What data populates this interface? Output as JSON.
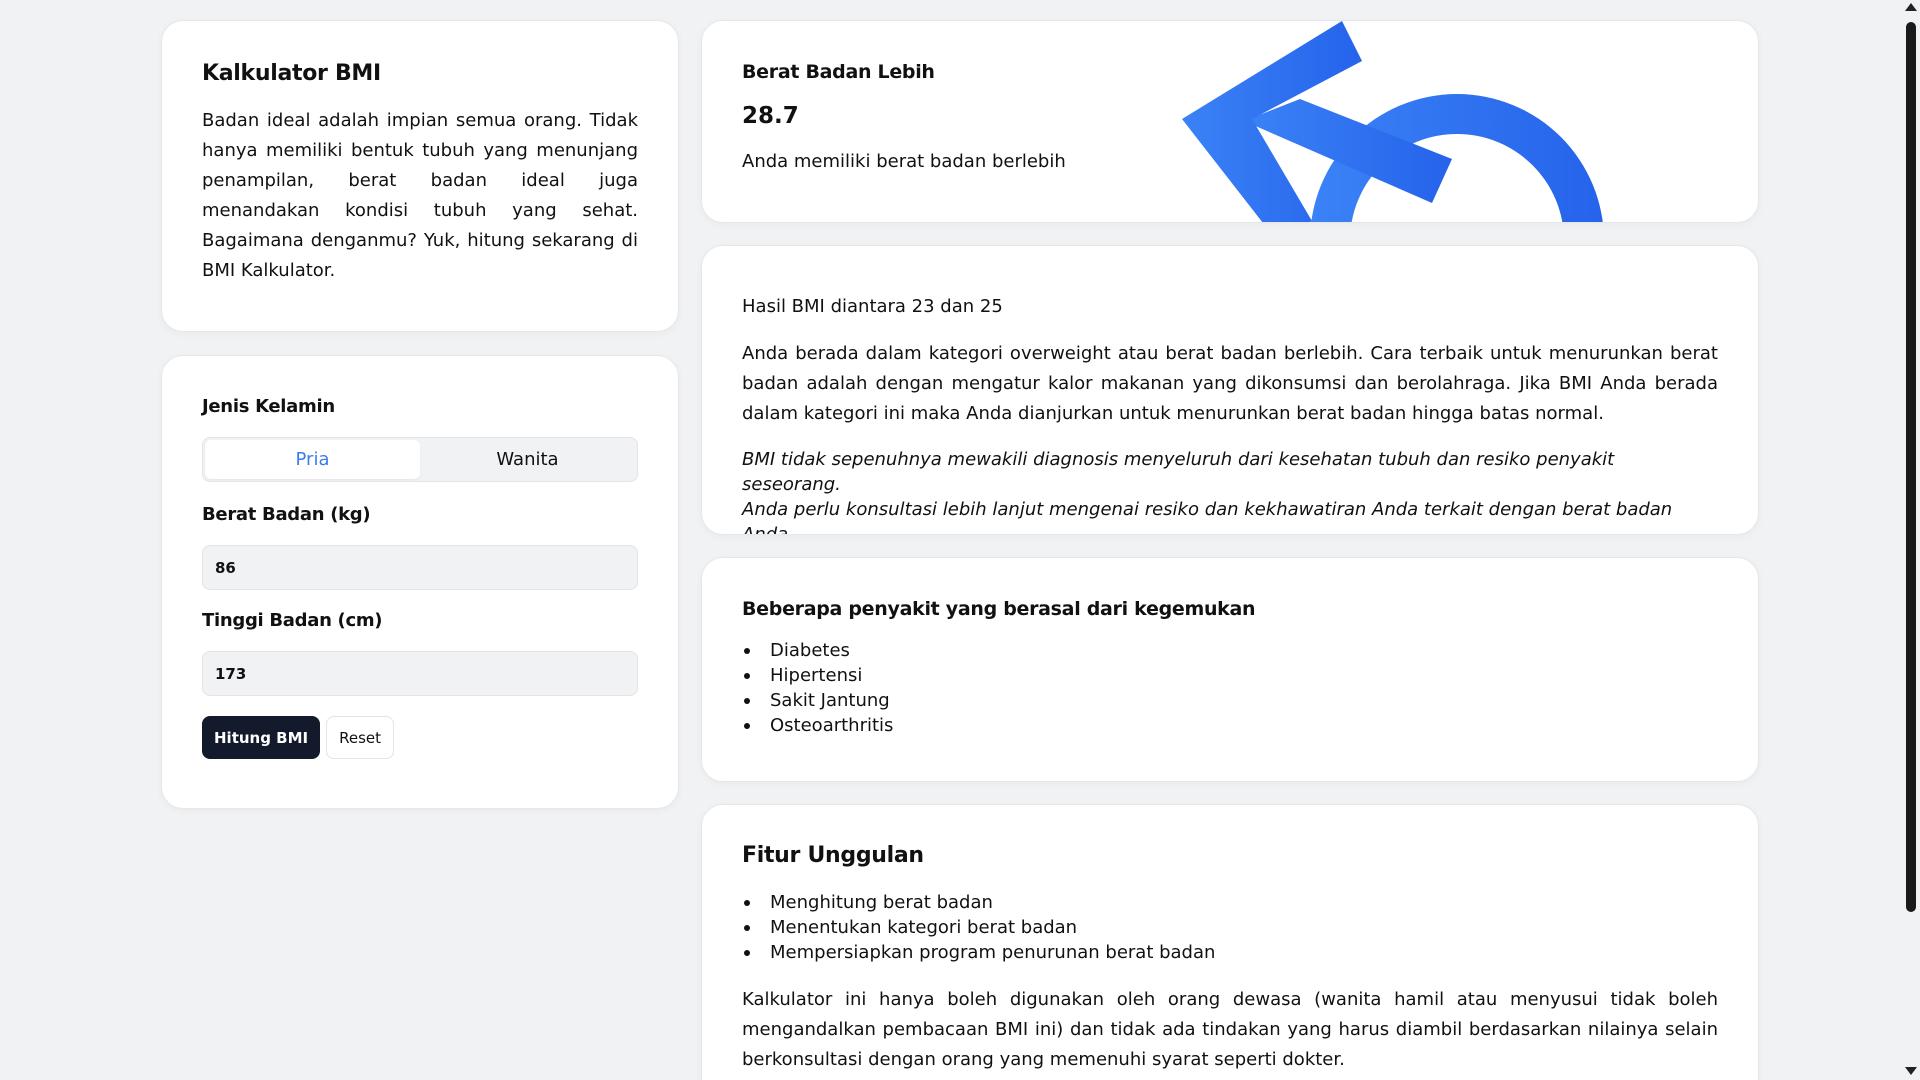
{
  "intro": {
    "title": "Kalkulator BMI",
    "text": "Badan ideal adalah impian semua orang. Tidak hanya memiliki bentuk tubuh yang menunjang penampilan, berat badan ideal juga menandakan kondisi tubuh yang sehat. Bagaimana denganmu? Yuk, hitung sekarang di BMI Kalkulator."
  },
  "form": {
    "gender_label": "Jenis Kelamin",
    "gender_options": [
      "Pria",
      "Wanita"
    ],
    "gender_selected": "Pria",
    "weight_label": "Berat Badan (kg)",
    "weight_value": "86",
    "height_label": "Tinggi Badan (cm)",
    "height_value": "173",
    "calc_button": "Hitung BMI",
    "reset_button": "Reset"
  },
  "result": {
    "category": "Berat Badan Lebih",
    "bmi": "28.7",
    "description": "Anda memiliki berat badan berlebih",
    "icon": "male-symbol-icon",
    "icon_color": "#3b7de9"
  },
  "detail": {
    "range": "Hasil BMI diantara 23 dan 25",
    "text": "Anda berada dalam kategori overweight atau berat badan berlebih. Cara terbaik untuk menurunkan berat badan adalah dengan mengatur kalor makanan yang dikonsumsi dan berolahraga. Jika BMI Anda berada dalam kategori ini maka Anda dianjurkan untuk menurunkan berat badan hingga batas normal.",
    "note_line1": "BMI tidak sepenuhnya mewakili diagnosis menyeluruh dari kesehatan tubuh dan resiko penyakit seseorang.",
    "note_line2": "Anda perlu konsultasi lebih lanjut mengenai resiko dan kekhawatiran Anda terkait dengan berat badan Anda."
  },
  "diseases": {
    "title": "Beberapa penyakit yang berasal dari kegemukan",
    "items": [
      "Diabetes",
      "Hipertensi",
      "Sakit Jantung",
      "Osteoarthritis"
    ]
  },
  "features": {
    "title": "Fitur Unggulan",
    "items": [
      "Menghitung berat badan",
      "Menentukan kategori berat badan",
      "Mempersiapkan program penurunan berat badan"
    ],
    "disclaimer": "Kalkulator ini hanya boleh digunakan oleh orang dewasa (wanita hamil atau menyusui tidak boleh mengandalkan pembacaan BMI ini) dan tidak ada tindakan yang harus diambil berdasarkan nilainya selain berkonsultasi dengan orang yang memenuhi syarat seperti dokter."
  },
  "colors": {
    "accent": "#3b7de9",
    "primary_button": "#131a2b",
    "background": "#f1f2f4"
  }
}
